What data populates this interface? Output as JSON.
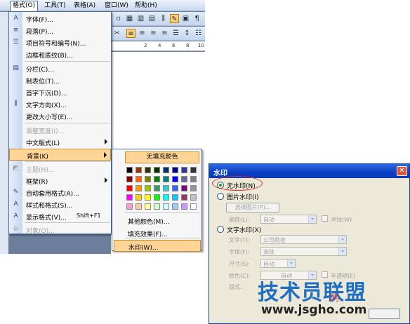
{
  "menubar": {
    "items": [
      "格式(O)",
      "工具(T)",
      "表格(A)",
      "窗口(W)",
      "帮助(H)"
    ],
    "active_index": 0
  },
  "ruler": {
    "ticks": [
      "2",
      "4",
      "6",
      "8",
      "10"
    ]
  },
  "format_menu": {
    "items": [
      {
        "label": "字体(F)...",
        "icon": "font-A-icon",
        "glyph": "A"
      },
      {
        "label": "段落(P)...",
        "icon": "paragraph-icon",
        "glyph": "≡"
      },
      {
        "label": "项目符号和编号(N)...",
        "icon": "bullets-icon",
        "glyph": "☰"
      },
      {
        "label": "边框和底纹(B)...",
        "icon": "",
        "glyph": ""
      },
      {
        "label": "分栏(C)...",
        "icon": "columns-icon",
        "glyph": "▤"
      },
      {
        "label": "制表位(T)...",
        "icon": "",
        "glyph": ""
      },
      {
        "label": "首字下沉(D)...",
        "icon": "",
        "glyph": ""
      },
      {
        "label": "文字方向(X)...",
        "icon": "text-direction-icon",
        "glyph": "⫼"
      },
      {
        "label": "更改大小写(E)...",
        "icon": "",
        "glyph": ""
      },
      {
        "label": "调整宽度(I)...",
        "icon": "",
        "glyph": "",
        "disabled": true
      },
      {
        "label": "中文版式(L)",
        "icon": "",
        "glyph": "",
        "submenu": true
      },
      {
        "label": "背景(K)",
        "icon": "",
        "glyph": "",
        "submenu": true,
        "highlighted": true
      },
      {
        "label": "主题(H)...",
        "icon": "theme-icon",
        "glyph": "◩",
        "disabled": true
      },
      {
        "label": "框架(R)",
        "icon": "",
        "glyph": "",
        "submenu": true
      },
      {
        "label": "自动套用格式(A)...",
        "icon": "autoformat-icon",
        "glyph": "✎"
      },
      {
        "label": "样式和格式(S)...",
        "icon": "styles-icon",
        "glyph": "A"
      },
      {
        "label": "显示格式(V)...",
        "icon": "reveal-format-icon",
        "glyph": "A",
        "shortcut": "Shift+F1"
      },
      {
        "label": "对象(O)...",
        "icon": "object-icon",
        "glyph": "⚙",
        "disabled": true
      }
    ]
  },
  "background_submenu": {
    "no_fill_label": "无填充颜色",
    "colors": [
      "#000000",
      "#993300",
      "#333300",
      "#003300",
      "#003366",
      "#000080",
      "#333399",
      "#333333",
      "#800000",
      "#ff6600",
      "#808000",
      "#008000",
      "#008080",
      "#0000ff",
      "#666699",
      "#808080",
      "#ff0000",
      "#ff9900",
      "#99cc00",
      "#339966",
      "#33cccc",
      "#3366ff",
      "#800080",
      "#969696",
      "#ff00ff",
      "#ffcc00",
      "#ffff00",
      "#00ff00",
      "#00ffff",
      "#00ccff",
      "#993366",
      "#c0c0c0",
      "#ff99cc",
      "#ffcc99",
      "#ffff99",
      "#ccffcc",
      "#ccffff",
      "#99ccff",
      "#cc99ff",
      "#ffffff"
    ],
    "items": [
      {
        "label": "其他颜色(M)..."
      },
      {
        "label": "填充效果(F)..."
      },
      {
        "label": "水印(W)...",
        "highlighted": true
      }
    ]
  },
  "watermark_dialog": {
    "title": "水印",
    "close_glyph": "✕",
    "options": {
      "none": "无水印(N)",
      "picture": "图片水印(I)",
      "text": "文字水印(X)"
    },
    "select_picture_button": "选择图片(P)...",
    "scale_label": "缩放(L):",
    "scale_value": "自动",
    "washout_label": "冲蚀(W)",
    "text_label": "文字(T):",
    "text_value": "公司绝密",
    "font_label": "字体(F):",
    "font_value": "宋体",
    "size_label": "尺寸(S):",
    "size_value": "自动",
    "color_label": "颜色(C):",
    "color_value": "自动",
    "semitransparent_label": "半透明(E)",
    "layout_label": "版式:"
  },
  "watermark_logo": {
    "main": "技术员联盟",
    "sub": "网",
    "url": "www.jsgho.com"
  }
}
